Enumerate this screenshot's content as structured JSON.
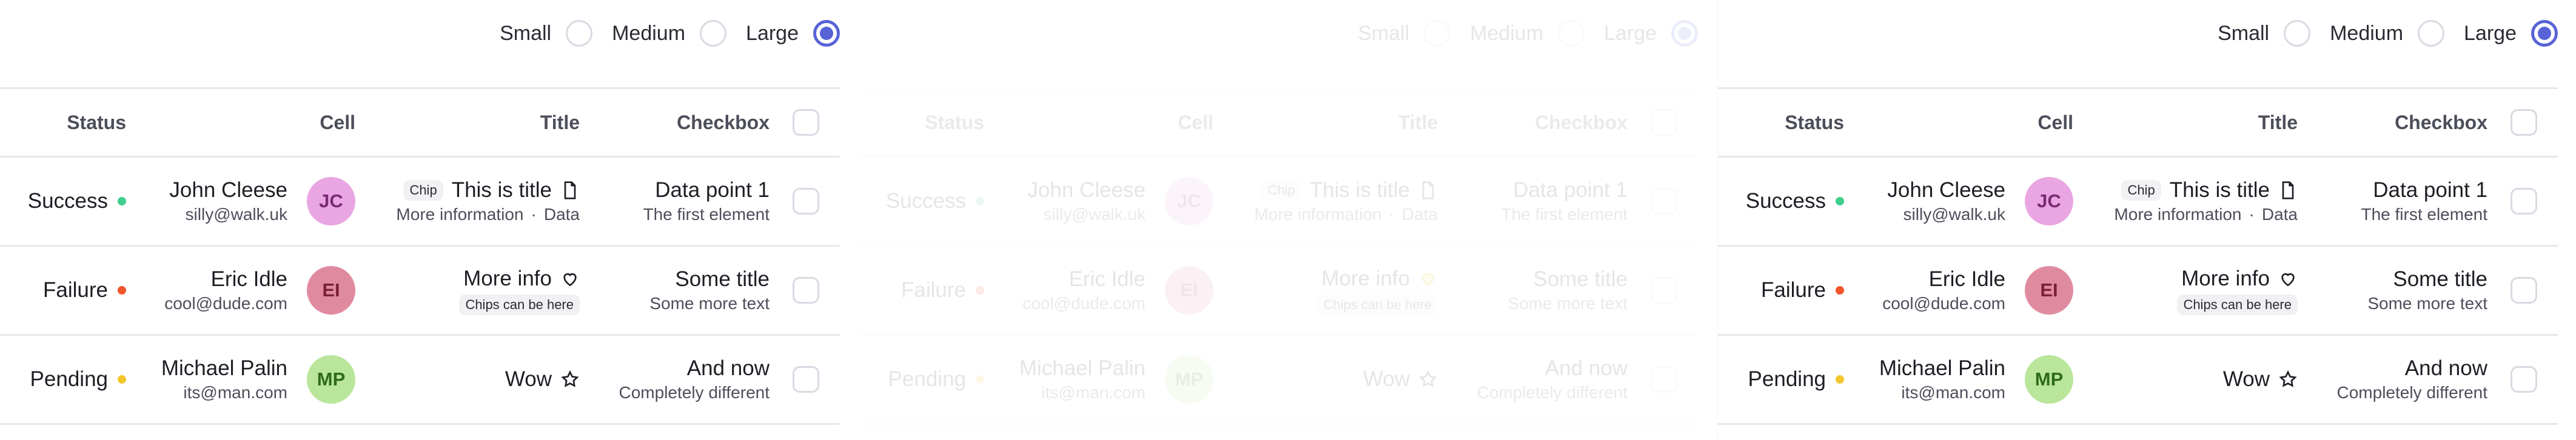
{
  "size_options": [
    "Small",
    "Medium",
    "Large"
  ],
  "selected_size": "Large",
  "columns": {
    "status": "Status",
    "cell": "Cell",
    "title": "Title",
    "checkbox": "Checkbox"
  },
  "rows": [
    {
      "status": "Success",
      "status_color": "#3ecf8e",
      "name": "John Cleese",
      "email": "silly@walk.uk",
      "initials": "JC",
      "avatar_bg": "#e9a6e2",
      "avatar_fg": "#7a2a72",
      "title_chip": "Chip",
      "title": "This is title",
      "title_icon": "document-icon",
      "title_sub_a": "More information",
      "title_sub_sep": "·",
      "title_sub_b": "Data",
      "check_title": "Data point 1",
      "check_sub": "The first element"
    },
    {
      "status": "Failure",
      "status_color": "#f0552b",
      "name": "Eric Idle",
      "email": "cool@dude.com",
      "initials": "EI",
      "avatar_bg": "#e08aa0",
      "avatar_fg": "#7b1f36",
      "title": "More info",
      "title_icon": "heart-icon",
      "title_chip_under": "Chips can be here",
      "check_title": "Some title",
      "check_sub": "Some more text"
    },
    {
      "status": "Pending",
      "status_color": "#f3c62b",
      "name": "Michael Palin",
      "email": "its@man.com",
      "initials": "MP",
      "avatar_bg": "#b9e69a",
      "avatar_fg": "#2f6a1d",
      "title": "Wow",
      "title_icon": "star-icon",
      "check_title": "And now",
      "check_sub": "Completely different"
    }
  ]
}
